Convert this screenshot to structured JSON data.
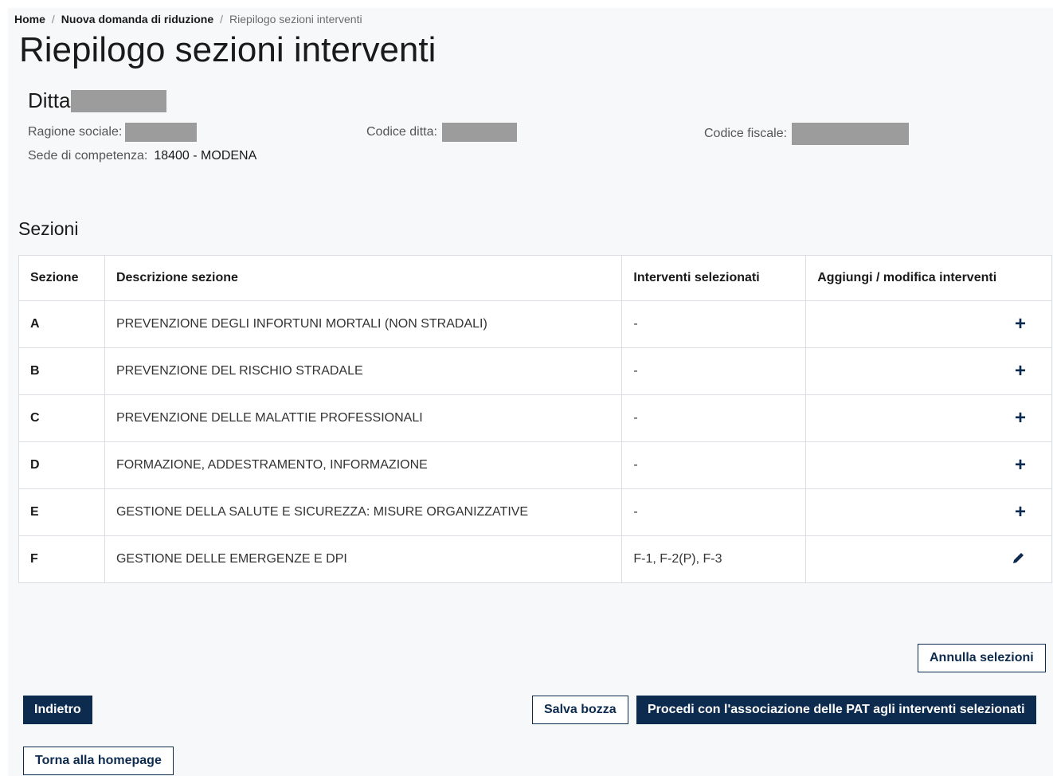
{
  "breadcrumb": {
    "items": [
      "Home",
      "Nuova domanda di riduzione"
    ],
    "current": "Riepilogo sezioni interventi"
  },
  "page_title": "Riepilogo sezioni interventi",
  "company": {
    "label": "Ditta",
    "ragione_sociale_label": "Ragione sociale:",
    "codice_ditta_label": "Codice ditta:",
    "codice_fiscale_label": "Codice fiscale:",
    "sede_label": "Sede di competenza:",
    "sede_value": "18400 - MODENA"
  },
  "sezioni": {
    "title": "Sezioni",
    "headers": [
      "Sezione",
      "Descrizione sezione",
      "Interventi selezionati",
      "Aggiungi / modifica interventi"
    ],
    "rows": [
      {
        "code": "A",
        "desc": "PREVENZIONE DEGLI INFORTUNI MORTALI (NON STRADALI)",
        "selected": "-",
        "action": "plus-icon"
      },
      {
        "code": "B",
        "desc": "PREVENZIONE DEL RISCHIO STRADALE",
        "selected": "-",
        "action": "plus-icon"
      },
      {
        "code": "C",
        "desc": "PREVENZIONE DELLE MALATTIE PROFESSIONALI",
        "selected": "-",
        "action": "plus-icon"
      },
      {
        "code": "D",
        "desc": "FORMAZIONE, ADDESTRAMENTO, INFORMAZIONE",
        "selected": "-",
        "action": "plus-icon"
      },
      {
        "code": "E",
        "desc": "GESTIONE DELLA SALUTE E SICUREZZA: MISURE ORGANIZZATIVE",
        "selected": "-",
        "action": "plus-icon"
      },
      {
        "code": "F",
        "desc": "GESTIONE DELLE EMERGENZE E DPI",
        "selected": "F-1, F-2(P), F-3",
        "action": "pencil-icon"
      }
    ]
  },
  "buttons": {
    "annulla": "Annulla selezioni",
    "indietro": "Indietro",
    "salva": "Salva bozza",
    "procedi": "Procedi con l'associazione delle PAT agli interventi selezionati",
    "torna": "Torna alla homepage"
  },
  "colors": {
    "primary": "#0d2b4f",
    "redaction": "#9c9c9c",
    "page_background": "#f7f8fa"
  }
}
